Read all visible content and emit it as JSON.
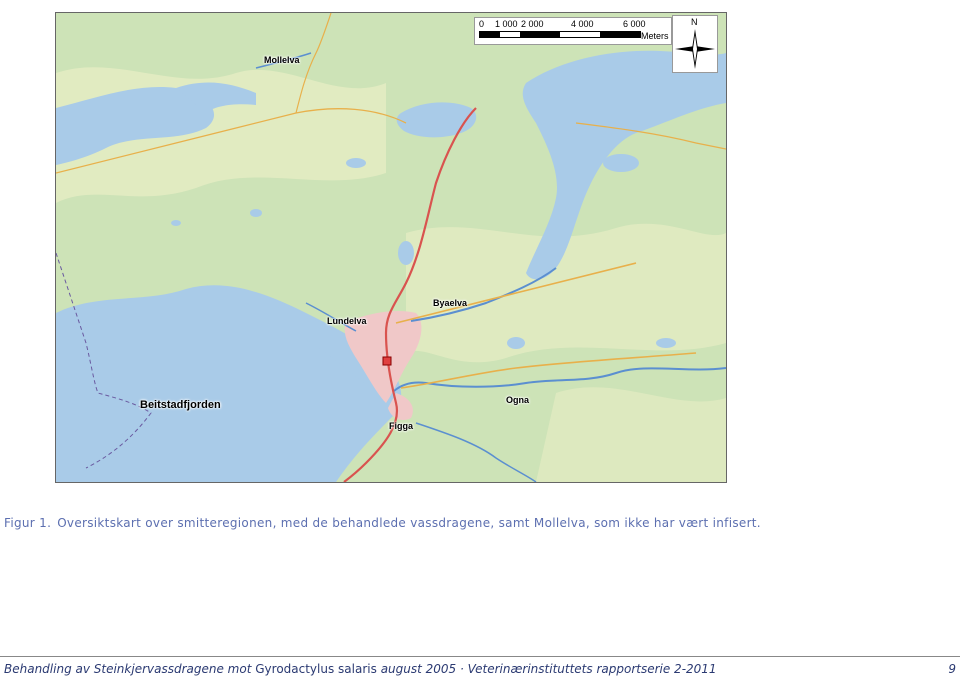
{
  "map": {
    "labels": {
      "mollelva": "Mollelva",
      "byaelva": "Byaelva",
      "lundelva": "Lundelva",
      "beitstadfjorden": "Beitstadfjorden",
      "ogna": "Ogna",
      "figga": "Figga"
    },
    "scale_ticks": [
      "0",
      "1 000",
      "2 000",
      "4 000",
      "6 000"
    ],
    "scale_unit": "Meters",
    "north_label": "N",
    "colors": {
      "water": "#a9cbe8",
      "forest": "#c9e0b4",
      "open": "#eef0c8",
      "urban": "#f0c8c8",
      "road": "#d9534f",
      "river": "#5b8fd0"
    }
  },
  "caption": {
    "label": "Figur 1.",
    "text": "Oversiktskart over smitteregionen, med de behandlede vassdragene, samt Mollelva, som ikke har vært infisert."
  },
  "footer": {
    "title_italic": "Behandling av Steinkjervassdragene mot",
    "species": "Gyrodactylus salaris",
    "rest_italic": "august 2005 · Veterinærinstituttets rapportserie 2-2011",
    "page_number": "9"
  }
}
